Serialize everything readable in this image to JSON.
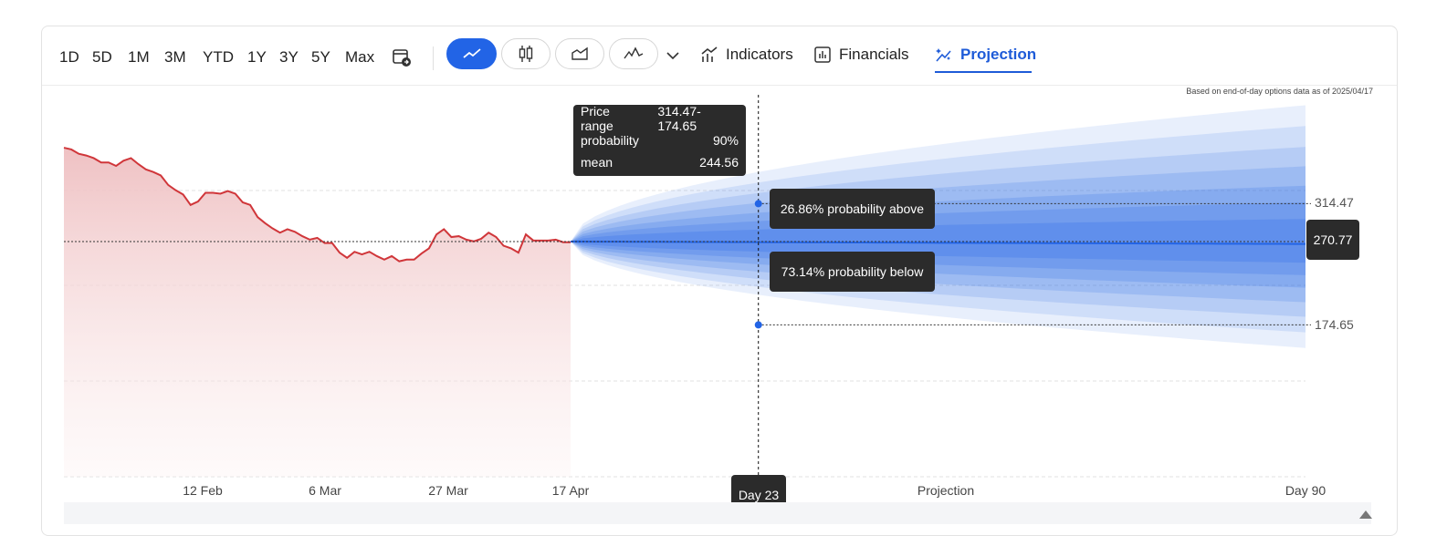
{
  "toolbar": {
    "ranges": [
      "1D",
      "5D",
      "1M",
      "3M",
      "YTD",
      "1Y",
      "3Y",
      "5Y",
      "Max"
    ],
    "indicators_label": "Indicators",
    "financials_label": "Financials",
    "projection_label": "Projection",
    "accent_color": "#2264e6"
  },
  "note": "Based on end-of-day options data as of 2025/04/17",
  "tooltip": {
    "price_range_label": "Price range",
    "price_range_value": "314.47-174.65",
    "probability_label": "probability",
    "probability_value": "90%",
    "mean_label": "mean",
    "mean_value": "244.56"
  },
  "above_label": "26.86% probability above",
  "below_label": "73.14% probability below",
  "current_price": "270.77",
  "upper_value": "314.47",
  "lower_value": "174.65",
  "crosshair_label": "Day 23",
  "x_labels": [
    "12 Feb",
    "6 Mar",
    "27 Mar",
    "17 Apr",
    "Projection",
    "Day 90"
  ],
  "chart_data": {
    "type": "area",
    "history_color": "#d0363a",
    "projection_color": "#2264e6",
    "history": [
      379,
      377,
      372,
      370,
      367,
      362,
      362,
      358,
      364,
      367,
      360,
      354,
      351,
      347,
      336,
      330,
      325,
      313,
      317,
      327,
      327,
      326,
      329,
      326,
      316,
      313,
      299,
      292,
      286,
      281,
      285,
      282,
      277,
      273,
      275,
      269,
      269,
      258,
      252,
      259,
      256,
      259,
      254,
      250,
      254,
      248,
      250,
      250,
      257,
      263,
      279,
      285,
      276,
      277,
      273,
      271,
      274,
      281,
      276,
      266,
      263,
      258,
      279,
      272,
      272,
      272,
      273,
      270,
      270
    ],
    "projection_days": 90,
    "projection_mean_start": 270.77,
    "projection_mean_end": 268,
    "band_90_at_day23": [
      174.65,
      314.47
    ],
    "reference_levels": [
      314.47,
      270.77,
      174.65
    ]
  }
}
